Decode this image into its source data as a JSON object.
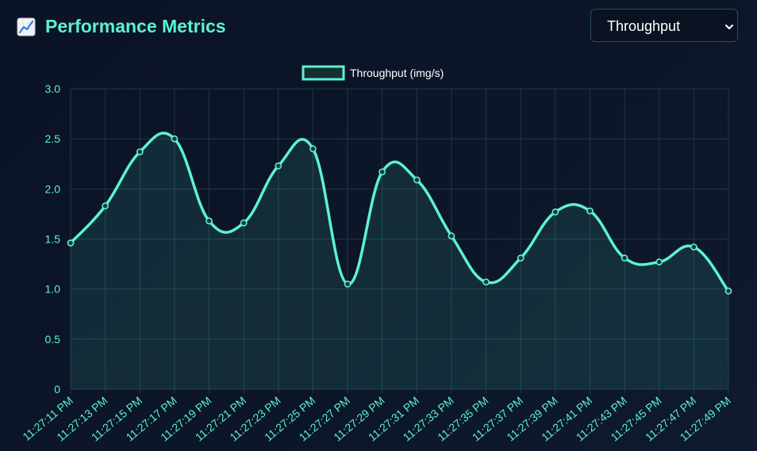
{
  "header": {
    "title": "Performance Metrics",
    "title_icon": "chart-increasing-icon"
  },
  "metric_select": {
    "value": "Throughput",
    "icon": "chevron-down-icon"
  },
  "colors": {
    "accent": "#5cf2d0",
    "background": "#0b1426",
    "grid": "#1c3a44",
    "tick_text": "#5cf2d0"
  },
  "chart_data": {
    "type": "area",
    "title": "",
    "xlabel": "",
    "ylabel": "",
    "legend": "top-center",
    "grid": true,
    "ylim": [
      0,
      3.0
    ],
    "yticks": [
      "0",
      "0.5",
      "1.0",
      "1.5",
      "2.0",
      "2.5",
      "3.0"
    ],
    "x": [
      "11:27:11 PM",
      "11:27:13 PM",
      "11:27:15 PM",
      "11:27:17 PM",
      "11:27:19 PM",
      "11:27:21 PM",
      "11:27:23 PM",
      "11:27:25 PM",
      "11:27:27 PM",
      "11:27:29 PM",
      "11:27:31 PM",
      "11:27:33 PM",
      "11:27:35 PM",
      "11:27:37 PM",
      "11:27:39 PM",
      "11:27:41 PM",
      "11:27:43 PM",
      "11:27:45 PM",
      "11:27:47 PM",
      "11:27:49 PM"
    ],
    "series": [
      {
        "name": "Throughput (img/s)",
        "values": [
          1.46,
          1.83,
          2.37,
          2.5,
          1.68,
          1.66,
          2.23,
          2.4,
          1.05,
          2.17,
          2.09,
          1.53,
          1.07,
          1.31,
          1.77,
          1.78,
          1.31,
          1.27,
          1.42,
          0.98
        ]
      }
    ]
  }
}
